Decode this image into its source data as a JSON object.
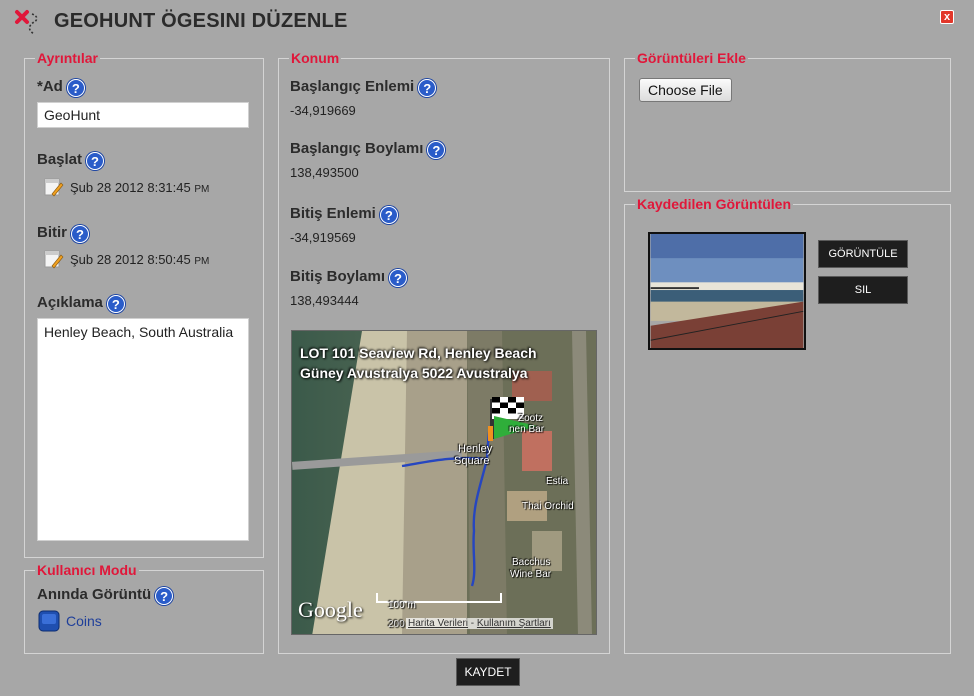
{
  "window": {
    "title": "GEOHUNT ÖGESINI DÜZENLE",
    "close_label": "x"
  },
  "details": {
    "legend": "Ayrıntılar",
    "name_label": "*Ad",
    "name_value": "GeoHunt",
    "start_label": "Başlat",
    "start_value": "Şub 28 2012 8:31:45",
    "start_ampm": "PM",
    "end_label": "Bitir",
    "end_value": "Şub 28 2012 8:50:45",
    "end_ampm": "PM",
    "description_label": "Açıklama",
    "description_value": "Henley Beach, South Australia"
  },
  "user_mode": {
    "legend": "Kullanıcı Modu",
    "instant_label": "Anında Görüntü",
    "coins_label": "Coins"
  },
  "location": {
    "legend": "Konum",
    "start_lat_label": "Başlangıç Enlemi",
    "start_lat_value": "-34,919669",
    "start_lon_label": "Başlangıç Boylamı",
    "start_lon_value": "138,493500",
    "end_lat_label": "Bitiş Enlemi",
    "end_lat_value": "-34,919569",
    "end_lon_label": "Bitiş Boylamı",
    "end_lon_value": "138,493444"
  },
  "map": {
    "address": "LOT 101 Seaview Rd, Henley Beach Güney Avustralya 5022 Avustralya",
    "labels": [
      "Zootz",
      "nen Bar",
      "Henley",
      "Square",
      "Estia",
      "Thai Orchid",
      "Bacchus",
      "Wine Bar"
    ],
    "google": "Google",
    "scale_m": "100 m",
    "scale_ft": "200",
    "data_link": "Harita Verileri",
    "separator": " - ",
    "terms_link": "Kullanım Şartları"
  },
  "add_images": {
    "legend": "Görüntüleri Ekle",
    "choose_file": "Choose File"
  },
  "saved_images": {
    "legend": "Kaydedilen Görüntülen",
    "view_button": "GÖRÜNTÜLE",
    "delete_button": "SIL"
  },
  "save_button": "KAYDET",
  "icons": {
    "help": "?",
    "help_icon": "question-circle-icon",
    "calendar_icon": "calendar-pencil-icon",
    "logo_icon": "red-x-route-icon"
  },
  "colors": {
    "legend": "#e0173a",
    "help": "#2a5cc9",
    "close": "#e2372a",
    "background": "#a7a7a7"
  }
}
